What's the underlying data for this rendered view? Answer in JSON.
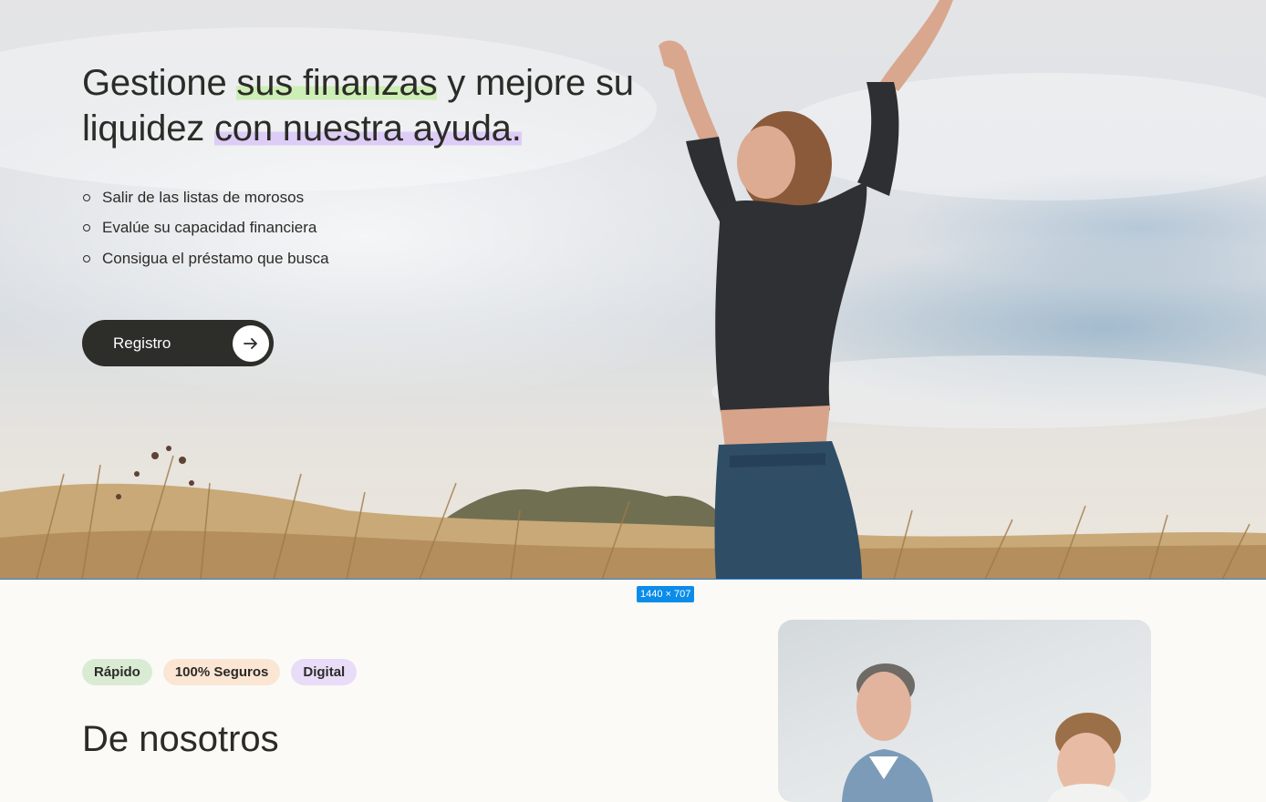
{
  "hero": {
    "title_part1": "Gestione ",
    "title_highlight1": "sus finanzas",
    "title_part2": " y mejore su liquidez ",
    "title_highlight2": "con nuestra ayuda.",
    "bullets": [
      "Salir de las listas de morosos",
      "Evalúe su capacidad financiera",
      "Consigua el préstamo que busca"
    ],
    "register_label": "Registro"
  },
  "frame_badge": "1440 × 707",
  "about": {
    "tags": [
      "Rápido",
      "100% Seguros",
      "Digital"
    ],
    "title": "De nosotros"
  },
  "colors": {
    "highlight_green": "#cdeeb5",
    "highlight_purple": "#ddcdf6",
    "button_dark": "#2d2d29",
    "tag_green": "#d9ecd3",
    "tag_orange": "#fbe6d4",
    "tag_purple": "#e9dcf8",
    "selection_blue": "#0c8ce9"
  },
  "icons": {
    "register_button": "arrow-right-icon",
    "bullet": "circle-outline-icon"
  }
}
